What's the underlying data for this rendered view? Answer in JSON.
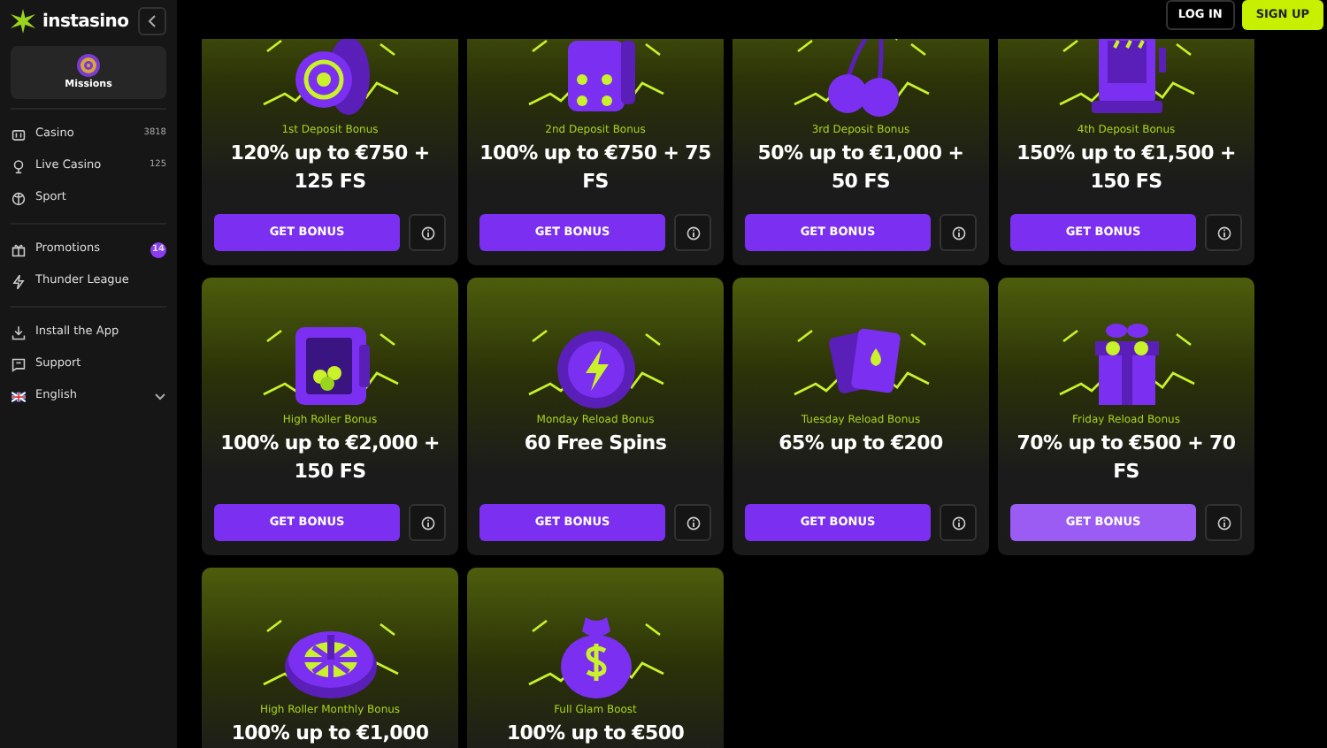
{
  "sidebar": {
    "logo": "instasino",
    "missions": "Missions",
    "groups": [
      [
        {
          "label": "Casino",
          "count": "3818"
        },
        {
          "label": "Live Casino",
          "count": "125"
        },
        {
          "label": "Sport"
        }
      ],
      [
        {
          "label": "Promotions",
          "badge": "14"
        },
        {
          "label": "Thunder League"
        }
      ],
      [
        {
          "label": "Install the App"
        },
        {
          "label": "Support"
        },
        {
          "label": "English",
          "dropdown": true
        }
      ]
    ]
  },
  "header": {
    "login": "LOG IN",
    "signup": "SIGN UP"
  },
  "bonuses": [
    {
      "subtitle": "1st Deposit Bonus",
      "title": "120% up to €750 + 125 FS",
      "button": "GET BONUS",
      "hovered": false
    },
    {
      "subtitle": "2nd Deposit Bonus",
      "title": "100% up to €750 + 75 FS",
      "button": "GET BONUS",
      "hovered": false
    },
    {
      "subtitle": "3rd Deposit Bonus",
      "title": "50% up to €1,000 + 50 FS",
      "button": "GET BONUS",
      "hovered": false
    },
    {
      "subtitle": "4th Deposit Bonus",
      "title": "150% up to €1,500 + 150 FS",
      "button": "GET BONUS",
      "hovered": false
    },
    {
      "subtitle": "High Roller Bonus",
      "title": "100% up to €2,000 + 150 FS",
      "button": "GET BONUS",
      "hovered": false
    },
    {
      "subtitle": "Monday Reload Bonus",
      "title": "60 Free Spins",
      "button": "GET BONUS",
      "hovered": false
    },
    {
      "subtitle": "Tuesday Reload Bonus",
      "title": "65% up to €200",
      "button": "GET BONUS",
      "hovered": false
    },
    {
      "subtitle": "Friday Reload Bonus",
      "title": "70% up to €500 + 70 FS",
      "button": "GET BONUS",
      "hovered": true
    },
    {
      "subtitle": "High Roller Monthly Bonus",
      "title": "100% up to €1,000"
    },
    {
      "subtitle": "Full Glam Boost",
      "title": "100% up to €500"
    }
  ]
}
